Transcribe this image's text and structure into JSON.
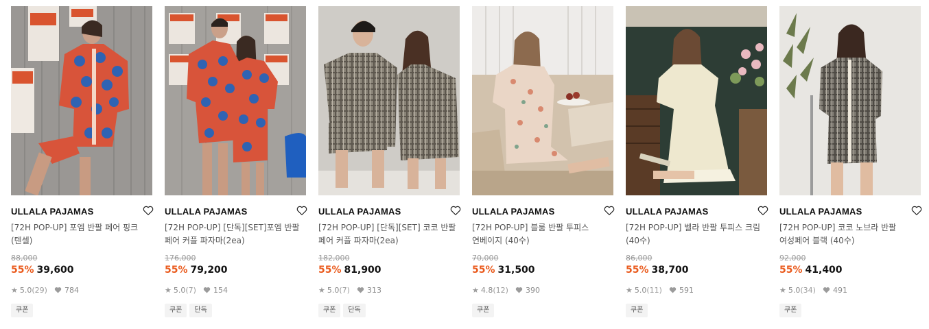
{
  "products": [
    {
      "brand": "ULLALA PAJAMAS",
      "name_line1": "[72H POP-UP] 포엠 반팔 페어 핑크",
      "name_line2": "(텐셀)",
      "original_price": "88,000",
      "discount_rate": "55%",
      "price": "39,600",
      "rating": "5.0",
      "review_count": "(29)",
      "likes": "784",
      "tags": [
        "쿠폰"
      ]
    },
    {
      "brand": "ULLALA PAJAMAS",
      "name_line1": "[72H POP-UP] [단독][SET]포엠 반팔",
      "name_line2": "페어 커플 파자마(2ea)",
      "original_price": "176,000",
      "discount_rate": "55%",
      "price": "79,200",
      "rating": "5.0",
      "review_count": "(7)",
      "likes": "154",
      "tags": [
        "쿠폰",
        "단독"
      ]
    },
    {
      "brand": "ULLALA PAJAMAS",
      "name_line1": "[72H POP-UP] [단독][SET] 코코 반팔",
      "name_line2": "페어 커플 파자마(2ea)",
      "original_price": "182,000",
      "discount_rate": "55%",
      "price": "81,900",
      "rating": "5.0",
      "review_count": "(7)",
      "likes": "313",
      "tags": [
        "쿠폰",
        "단독"
      ]
    },
    {
      "brand": "ULLALA PAJAMAS",
      "name_line1": "[72H POP-UP] 블룸 반팔 투피스",
      "name_line2": "연베이지 (40수)",
      "original_price": "70,000",
      "discount_rate": "55%",
      "price": "31,500",
      "rating": "4.8",
      "review_count": "(12)",
      "likes": "390",
      "tags": [
        "쿠폰"
      ]
    },
    {
      "brand": "ULLALA PAJAMAS",
      "name_line1": "[72H POP-UP] 벨라 반팔 투피스 크림",
      "name_line2": "(40수)",
      "original_price": "86,000",
      "discount_rate": "55%",
      "price": "38,700",
      "rating": "5.0",
      "review_count": "(11)",
      "likes": "591",
      "tags": [
        "쿠폰"
      ]
    },
    {
      "brand": "ULLALA PAJAMAS",
      "name_line1": "[72H POP-UP] 코코 노브라 반팔",
      "name_line2": "여성페어 블랙 (40수)",
      "original_price": "92,000",
      "discount_rate": "55%",
      "price": "41,400",
      "rating": "5.0",
      "review_count": "(34)",
      "likes": "491",
      "tags": [
        "쿠폰"
      ]
    }
  ],
  "icons": {
    "wishlist": "heart-outline-icon",
    "rating": "star-icon",
    "likes": "heart-filled-icon"
  },
  "colors": {
    "discount": "#ea5a1c",
    "tag_bg": "#f3f3f3"
  }
}
